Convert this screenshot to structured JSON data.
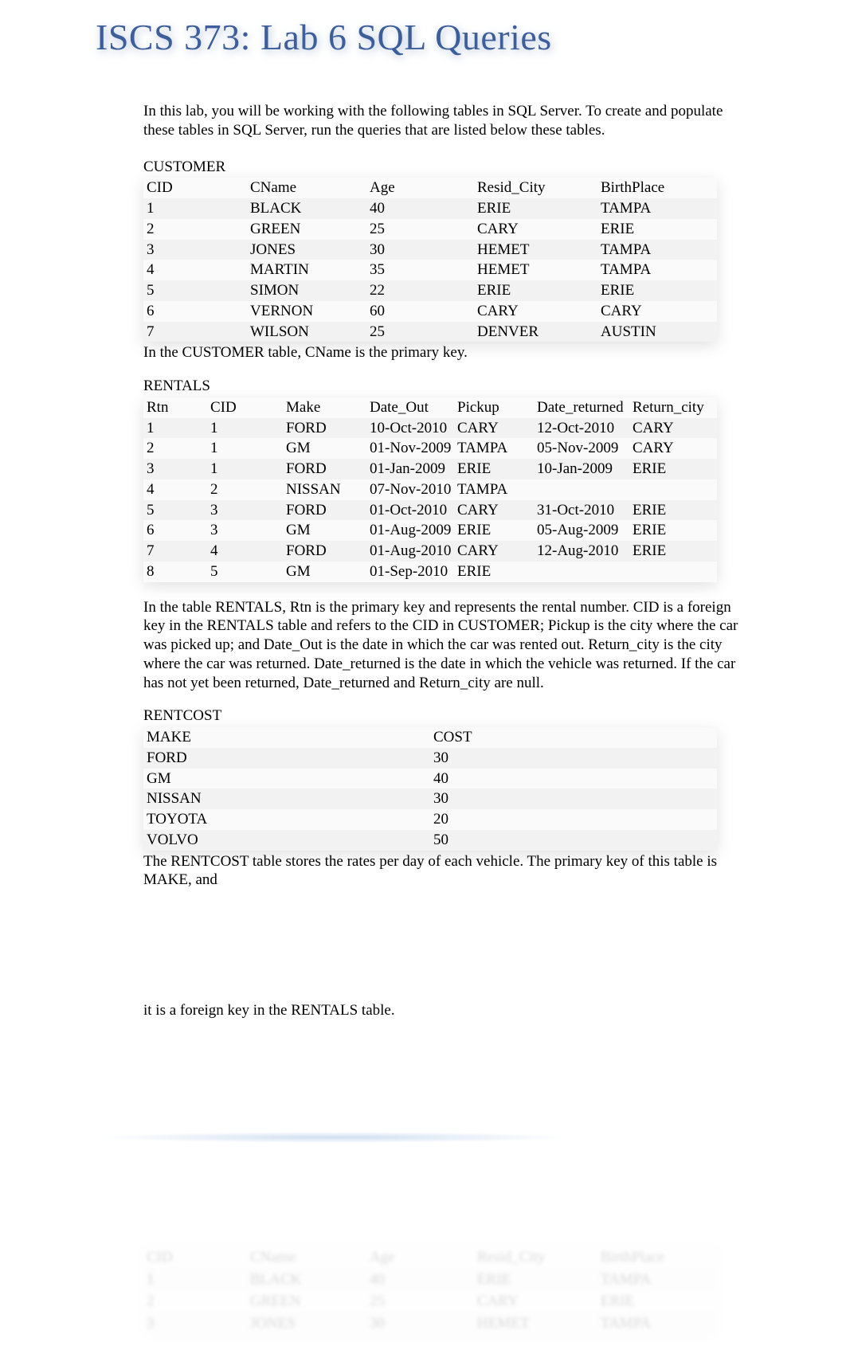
{
  "title": "ISCS 373:  Lab 6 SQL Queries",
  "intro": "In this lab, you will be working with the following tables in SQL Server.   To create and populate these tables in SQL Server, run the queries that are listed below these tables.",
  "customer": {
    "label": "CUSTOMER",
    "headers": [
      "CID",
      "CName",
      "Age",
      "Resid_City",
      "BirthPlace"
    ],
    "rows": [
      [
        "1",
        "BLACK",
        "40",
        "ERIE",
        "TAMPA"
      ],
      [
        "2",
        "GREEN",
        "25",
        "CARY",
        "ERIE"
      ],
      [
        "3",
        "JONES",
        "30",
        "HEMET",
        "TAMPA"
      ],
      [
        "4",
        "MARTIN",
        "35",
        "HEMET",
        "TAMPA"
      ],
      [
        "5",
        "SIMON",
        "22",
        "ERIE",
        "ERIE"
      ],
      [
        "6",
        "VERNON",
        "60",
        "CARY",
        "CARY"
      ],
      [
        "7",
        "WILSON",
        "25",
        "DENVER",
        "AUSTIN"
      ]
    ],
    "note": "In the CUSTOMER table, CName is the primary key."
  },
  "rentals": {
    "label": "RENTALS",
    "headers": [
      "Rtn",
      "CID",
      "Make",
      "Date_Out",
      "Pickup",
      "Date_returned",
      "Return_city"
    ],
    "rows": [
      [
        "1",
        "1",
        "FORD",
        "10-Oct-2010",
        "CARY",
        "12-Oct-2010",
        "CARY"
      ],
      [
        "2",
        "1",
        "GM",
        "01-Nov-2009",
        "TAMPA",
        "05-Nov-2009",
        "CARY"
      ],
      [
        "3",
        "1",
        "FORD",
        "01-Jan-2009",
        "ERIE",
        "10-Jan-2009",
        "ERIE"
      ],
      [
        "4",
        "2",
        "NISSAN",
        "07-Nov-2010",
        "TAMPA",
        "",
        ""
      ],
      [
        "5",
        "3",
        "FORD",
        "01-Oct-2010",
        "CARY",
        "31-Oct-2010",
        "ERIE"
      ],
      [
        "6",
        "3",
        "GM",
        "01-Aug-2009",
        "ERIE",
        "05-Aug-2009",
        "ERIE"
      ],
      [
        "7",
        "4",
        "FORD",
        "01-Aug-2010",
        "CARY",
        "12-Aug-2010",
        "ERIE"
      ],
      [
        "8",
        "5",
        "GM",
        "01-Sep-2010",
        "ERIE",
        "",
        ""
      ]
    ],
    "note": "In the table RENTALS, Rtn is the primary key and represents the rental number. CID is a foreign key in the RENTALS table and refers to the CID in CUSTOMER; Pickup is the city where the car was picked up; and Date_Out is the date in which the car was rented out.       Return_city is the city where the car was returned.    Date_returned is the date in which the vehicle was returned.       If the car has not yet been returned,    Date_returned and Return_city are null."
  },
  "rentcost": {
    "label": "RENTCOST",
    "headers": [
      "MAKE",
      "COST"
    ],
    "rows": [
      [
        "FORD",
        "30"
      ],
      [
        "GM",
        "40"
      ],
      [
        "NISSAN",
        "30"
      ],
      [
        "TOYOTA",
        "20"
      ],
      [
        "VOLVO",
        "50"
      ]
    ],
    "note1": "The RENTCOST table stores the rates per day of each vehicle.  The primary key of this table is MAKE, and",
    "note2": "it is a foreign key in the RENTALS table."
  },
  "ghost": {
    "headers": [
      "CID",
      "CName",
      "Age",
      "Resid_City",
      "BirthPlace"
    ],
    "rows": [
      [
        "1",
        "BLACK",
        "40",
        "ERIE",
        "TAMPA"
      ],
      [
        "2",
        "GREEN",
        "25",
        "CARY",
        "ERIE"
      ],
      [
        "3",
        "JONES",
        "30",
        "HEMET",
        "TAMPA"
      ]
    ]
  }
}
